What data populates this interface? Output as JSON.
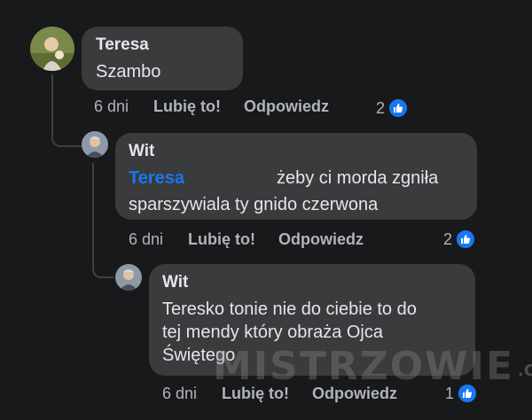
{
  "comments": [
    {
      "author": "Teresa",
      "text": "Szambo",
      "time": "6 dni",
      "like_label": "Lubię to!",
      "reply_label": "Odpowiedz",
      "reaction_count": "2"
    },
    {
      "author": "Wit",
      "mention": "Teresa",
      "text_line1": "żeby ci morda zgniła",
      "text_line2": "sparszywiala ty gnido czerwona",
      "time": "6 dni",
      "like_label": "Lubię to!",
      "reply_label": "Odpowiedz",
      "reaction_count": "2"
    },
    {
      "author": "Wit",
      "text_line1": "Teresko tonie nie do ciebie to do",
      "text_line2": "tej mendy który obraża Ojca",
      "text_line3": "Świętego",
      "time": "6 dni",
      "like_label": "Lubię to!",
      "reply_label": "Odpowiedz",
      "reaction_count": "1"
    }
  ],
  "watermark": {
    "main": "MISTRZOWIE",
    "suffix": ".ORG"
  },
  "colors": {
    "background": "#18191a",
    "bubble": "#3a3b3c",
    "mention": "#1877f2",
    "like_badge": "#1877f2"
  },
  "icons": {
    "reaction": "like-thumb-icon"
  }
}
